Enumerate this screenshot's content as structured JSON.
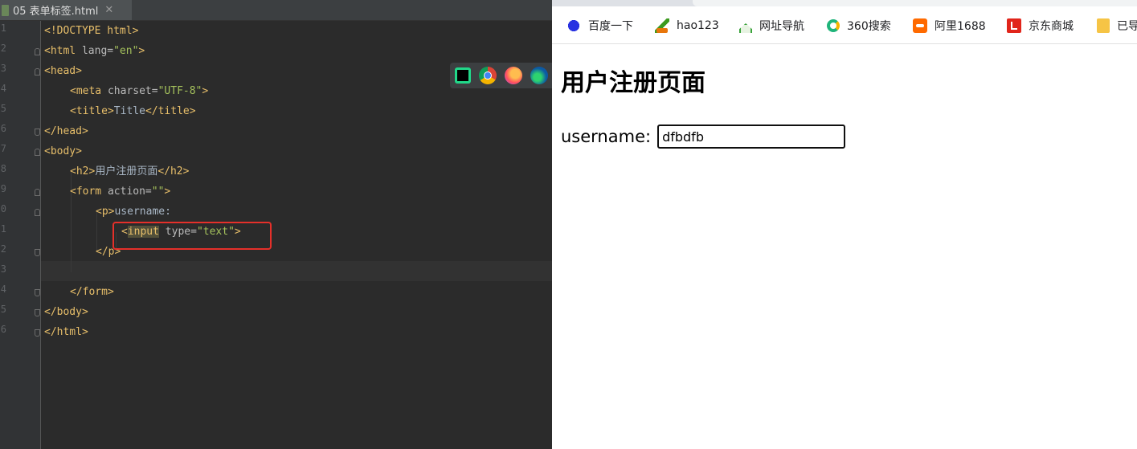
{
  "ide": {
    "tab": {
      "filename": "05 表单标签.html",
      "close_glyph": "✕"
    },
    "line_numbers": [
      "1",
      "2",
      "3",
      "4",
      "5",
      "6",
      "7",
      "8",
      "9",
      "0",
      "1",
      "2",
      "3",
      "4",
      "5",
      "6"
    ],
    "code": {
      "l1": "<!DOCTYPE html>",
      "l2_open": "<html",
      "l2_attr": " lang=",
      "l2_val": "\"en\"",
      "l2_close": ">",
      "l3": "<head>",
      "l4_open": "<meta",
      "l4_attr": " charset=",
      "l4_val": "\"UTF-8\"",
      "l4_close": ">",
      "l5_open": "<title>",
      "l5_text": "Title",
      "l5_close": "</title>",
      "l6": "</head>",
      "l7": "<body>",
      "l8_open": "<h2>",
      "l8_text": "用户注册页面",
      "l8_close": "</h2>",
      "l9_open": "<form",
      "l9_attr": " action=",
      "l9_val": "\"\"",
      "l9_close": ">",
      "l10_open": "<p>",
      "l10_text": "username:",
      "l11_lt": "<",
      "l11_tag": "input",
      "l11_attr": " type=",
      "l11_val": "\"text\"",
      "l11_close": ">",
      "l12": "</p>",
      "l14": "</form>",
      "l15": "</body>",
      "l16": "</html>"
    },
    "browser_icons": [
      "pycharm-icon",
      "chrome-icon",
      "firefox-icon",
      "edge-icon"
    ]
  },
  "browser": {
    "bookmarks": [
      {
        "label": "百度一下",
        "icon": "baidu-icon"
      },
      {
        "label": "hao123",
        "icon": "hao123-icon"
      },
      {
        "label": "网址导航",
        "icon": "2345-nav-icon"
      },
      {
        "label": "360搜索",
        "icon": "360-search-icon"
      },
      {
        "label": "阿里1688",
        "icon": "alibaba-1688-icon"
      },
      {
        "label": "京东商城",
        "icon": "jd-icon"
      },
      {
        "label": "已导",
        "icon": "folder-icon"
      }
    ],
    "page": {
      "heading": "用户注册页面",
      "username_label": "username:",
      "username_value": "dfbdfb"
    }
  },
  "colors": {
    "ide_bg": "#2b2b2b",
    "tag": "#e8bf6a",
    "string": "#a5c25c",
    "annotation_box": "#e5302a"
  }
}
